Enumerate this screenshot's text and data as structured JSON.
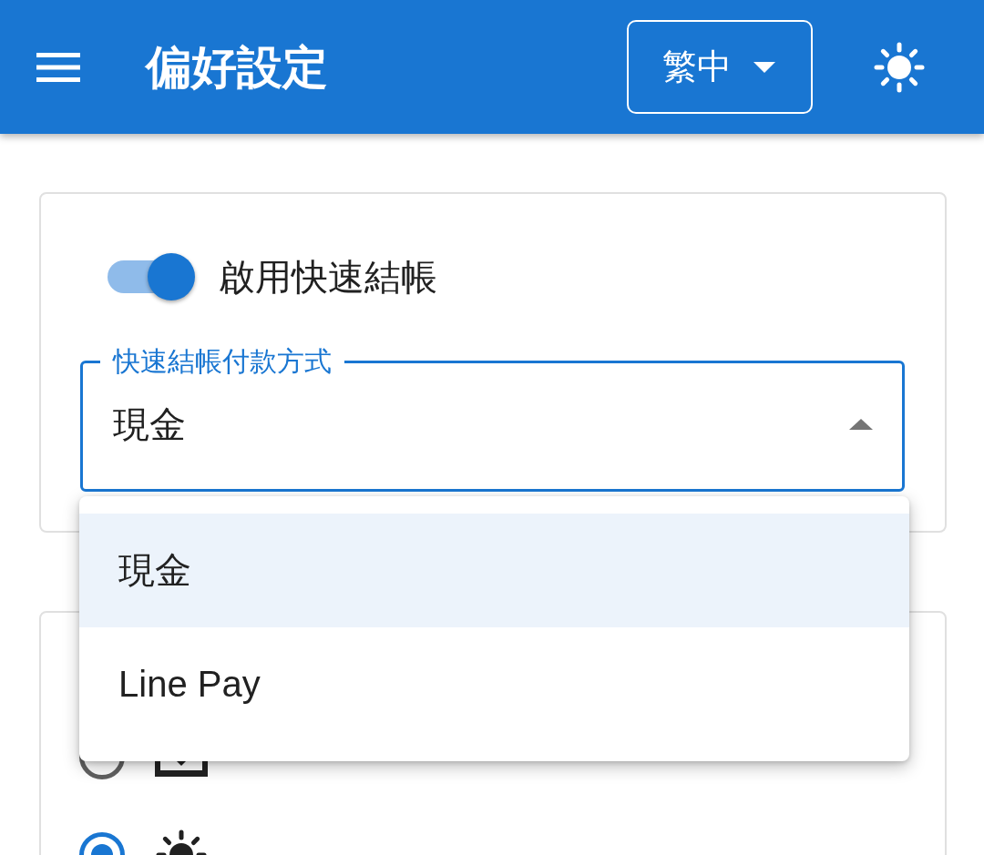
{
  "app_bar": {
    "title": "偏好設定",
    "language_button": {
      "label": "繁中"
    }
  },
  "quick_checkout": {
    "toggle": {
      "label": "啟用快速結帳",
      "on": true
    },
    "payment_select": {
      "label": "快速結帳付款方式",
      "value": "現金",
      "expanded": true,
      "options": [
        {
          "label": "現金",
          "selected": true
        },
        {
          "label": "Line Pay",
          "selected": false
        }
      ]
    }
  },
  "theme": {
    "options": [
      {
        "kind": "system",
        "selected": false
      },
      {
        "kind": "light",
        "selected": true
      }
    ]
  }
}
